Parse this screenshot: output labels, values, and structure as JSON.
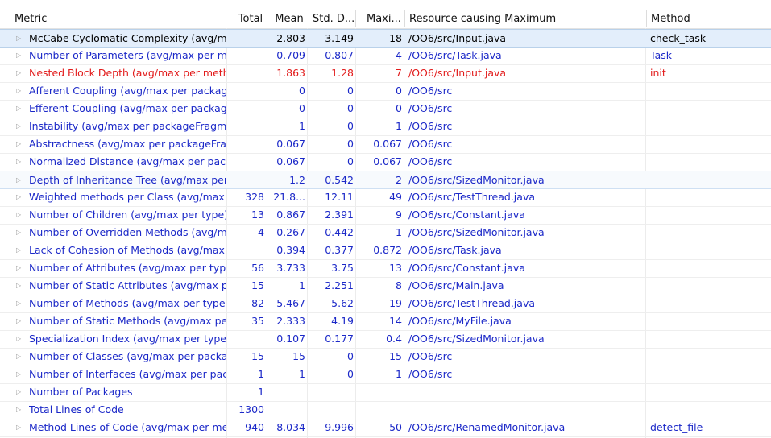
{
  "colors": {
    "normal": "#1b28c8",
    "warning": "#e21b1b",
    "header_text": "#111111",
    "arrow": "#9a9a9a"
  },
  "headers": {
    "metric": "Metric",
    "total": "Total",
    "mean": "Mean",
    "std": "Std. D...",
    "max": "Maxi...",
    "resource": "Resource causing Maximum",
    "method": "Method"
  },
  "rows": [
    {
      "metric": "McCabe Cyclomatic Complexity (avg/max per method)",
      "total": "",
      "mean": "2.803",
      "std": "3.149",
      "max": "18",
      "resource": "/OO6/src/Input.java",
      "method": "check_task",
      "state": "selected",
      "color": "selected"
    },
    {
      "metric": "Number of Parameters (avg/max per method)",
      "total": "",
      "mean": "0.709",
      "std": "0.807",
      "max": "4",
      "resource": "/OO6/src/Task.java",
      "method": "Task",
      "state": "",
      "color": "normal"
    },
    {
      "metric": "Nested Block Depth (avg/max per method)",
      "total": "",
      "mean": "1.863",
      "std": "1.28",
      "max": "7",
      "resource": "/OO6/src/Input.java",
      "method": "init",
      "state": "",
      "color": "warning"
    },
    {
      "metric": "Afferent Coupling (avg/max per packageFragment)",
      "total": "",
      "mean": "0",
      "std": "0",
      "max": "0",
      "resource": "/OO6/src",
      "method": "",
      "state": "",
      "color": "normal"
    },
    {
      "metric": "Efferent Coupling (avg/max per packageFragment)",
      "total": "",
      "mean": "0",
      "std": "0",
      "max": "0",
      "resource": "/OO6/src",
      "method": "",
      "state": "",
      "color": "normal"
    },
    {
      "metric": "Instability (avg/max per packageFragment)",
      "total": "",
      "mean": "1",
      "std": "0",
      "max": "1",
      "resource": "/OO6/src",
      "method": "",
      "state": "",
      "color": "normal"
    },
    {
      "metric": "Abstractness (avg/max per packageFragment)",
      "total": "",
      "mean": "0.067",
      "std": "0",
      "max": "0.067",
      "resource": "/OO6/src",
      "method": "",
      "state": "",
      "color": "normal"
    },
    {
      "metric": "Normalized Distance (avg/max per packageFragment)",
      "total": "",
      "mean": "0.067",
      "std": "0",
      "max": "0.067",
      "resource": "/OO6/src",
      "method": "",
      "state": "",
      "color": "normal"
    },
    {
      "metric": "Depth of Inheritance Tree (avg/max per type)",
      "total": "",
      "mean": "1.2",
      "std": "0.542",
      "max": "2",
      "resource": "/OO6/src/SizedMonitor.java",
      "method": "",
      "state": "hover",
      "color": "normal"
    },
    {
      "metric": "Weighted methods per Class (avg/max per type)",
      "total": "328",
      "mean": "21.8...",
      "std": "12.11",
      "max": "49",
      "resource": "/OO6/src/TestThread.java",
      "method": "",
      "state": "",
      "color": "normal"
    },
    {
      "metric": "Number of Children (avg/max per type)",
      "total": "13",
      "mean": "0.867",
      "std": "2.391",
      "max": "9",
      "resource": "/OO6/src/Constant.java",
      "method": "",
      "state": "",
      "color": "normal"
    },
    {
      "metric": "Number of Overridden Methods (avg/max per type)",
      "total": "4",
      "mean": "0.267",
      "std": "0.442",
      "max": "1",
      "resource": "/OO6/src/SizedMonitor.java",
      "method": "",
      "state": "",
      "color": "normal"
    },
    {
      "metric": "Lack of Cohesion of Methods (avg/max per type)",
      "total": "",
      "mean": "0.394",
      "std": "0.377",
      "max": "0.872",
      "resource": "/OO6/src/Task.java",
      "method": "",
      "state": "",
      "color": "normal"
    },
    {
      "metric": "Number of Attributes (avg/max per type)",
      "total": "56",
      "mean": "3.733",
      "std": "3.75",
      "max": "13",
      "resource": "/OO6/src/Constant.java",
      "method": "",
      "state": "",
      "color": "normal"
    },
    {
      "metric": "Number of Static Attributes (avg/max per type)",
      "total": "15",
      "mean": "1",
      "std": "2.251",
      "max": "8",
      "resource": "/OO6/src/Main.java",
      "method": "",
      "state": "",
      "color": "normal"
    },
    {
      "metric": "Number of Methods (avg/max per type)",
      "total": "82",
      "mean": "5.467",
      "std": "5.62",
      "max": "19",
      "resource": "/OO6/src/TestThread.java",
      "method": "",
      "state": "",
      "color": "normal"
    },
    {
      "metric": "Number of Static Methods (avg/max per type)",
      "total": "35",
      "mean": "2.333",
      "std": "4.19",
      "max": "14",
      "resource": "/OO6/src/MyFile.java",
      "method": "",
      "state": "",
      "color": "normal"
    },
    {
      "metric": "Specialization Index (avg/max per type)",
      "total": "",
      "mean": "0.107",
      "std": "0.177",
      "max": "0.4",
      "resource": "/OO6/src/SizedMonitor.java",
      "method": "",
      "state": "",
      "color": "normal"
    },
    {
      "metric": "Number of Classes (avg/max per packageFragment)",
      "total": "15",
      "mean": "15",
      "std": "0",
      "max": "15",
      "resource": "/OO6/src",
      "method": "",
      "state": "",
      "color": "normal"
    },
    {
      "metric": "Number of Interfaces (avg/max per packageFragment)",
      "total": "1",
      "mean": "1",
      "std": "0",
      "max": "1",
      "resource": "/OO6/src",
      "method": "",
      "state": "",
      "color": "normal"
    },
    {
      "metric": "Number of Packages",
      "total": "1",
      "mean": "",
      "std": "",
      "max": "",
      "resource": "",
      "method": "",
      "state": "",
      "color": "normal"
    },
    {
      "metric": "Total Lines of Code",
      "total": "1300",
      "mean": "",
      "std": "",
      "max": "",
      "resource": "",
      "method": "",
      "state": "",
      "color": "normal"
    },
    {
      "metric": "Method Lines of Code (avg/max per method)",
      "total": "940",
      "mean": "8.034",
      "std": "9.996",
      "max": "50",
      "resource": "/OO6/src/RenamedMonitor.java",
      "method": "detect_file",
      "state": "",
      "color": "normal"
    }
  ]
}
